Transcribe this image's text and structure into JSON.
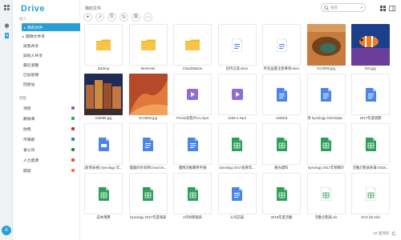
{
  "app": {
    "logo": "Drive"
  },
  "rail": {
    "icons": [
      "grid-icon",
      "bell-icon",
      "document-icon"
    ],
    "avatar": "A"
  },
  "sidebar": {
    "section_mine": "個人",
    "items": [
      {
        "label": "我的文件",
        "active": true,
        "caret": "▸"
      },
      {
        "label": "團隊文件夾",
        "caret": "▸"
      },
      {
        "label": "與我共享"
      },
      {
        "label": "與他人共享"
      },
      {
        "label": "最近瀏覽"
      },
      {
        "label": "已加星標"
      },
      {
        "label": "回收站"
      }
    ],
    "section_labels": "標籤",
    "labels": [
      {
        "label": "項目",
        "color": "#9b59b6"
      },
      {
        "label": "數據庫",
        "color": "#27ae60"
      },
      {
        "label": "財務",
        "color": "#c0392b"
      },
      {
        "label": "市場部",
        "color": "#2980b9"
      },
      {
        "label": "會公司",
        "color": "#1e8449"
      },
      {
        "label": "人力資源",
        "color": "#e74c3c"
      },
      {
        "label": "開發",
        "color": "#e67e22"
      }
    ]
  },
  "header": {
    "breadcrumb": "我的文件",
    "search_placeholder": "搜尋",
    "search_dropdown": "▾"
  },
  "toolbar": {
    "buttons": [
      "+",
      "↗",
      "⎘",
      "↻",
      "⧉",
      "⋯"
    ]
  },
  "files": [
    {
      "name": "Backup",
      "kind": "folder"
    },
    {
      "name": "Moments",
      "kind": "folder"
    },
    {
      "name": "CloudStation",
      "kind": "folder"
    },
    {
      "name": "招待方案.docx",
      "kind": "doc-light"
    },
    {
      "name": "所有設置注意事項.docx",
      "kind": "doc-light"
    },
    {
      "name": "GC0000.jpg",
      "kind": "img-canyon"
    },
    {
      "name": "fish.jpg",
      "kind": "img-fish"
    },
    {
      "name": "GM089.jpg",
      "kind": "img-town"
    },
    {
      "name": "GC0002.jpg",
      "kind": "img-rock"
    },
    {
      "name": "Presto短影片V1.mp4",
      "kind": "video"
    },
    {
      "name": "1268-1.mp4",
      "kind": "video"
    },
    {
      "name": "Untitled",
      "kind": "doc"
    },
    {
      "name": "用 Synology DS218pla...",
      "kind": "doc"
    },
    {
      "name": "2017年度規劃",
      "kind": "doc"
    },
    {
      "name": "[新增表格] Synology 年...",
      "kind": "slide"
    },
    {
      "name": "電腦同步與用Cloud St...",
      "kind": "doc"
    },
    {
      "name": "團隊活動費用申請",
      "kind": "doc"
    },
    {
      "name": "Synology 2017股東年...",
      "kind": "sheet"
    },
    {
      "name": "觀光資料",
      "kind": "sheet"
    },
    {
      "name": "Synology 2017年預算計",
      "kind": "sheet"
    },
    {
      "name": "活動計劃表負責-2018...",
      "kind": "sheet"
    },
    {
      "name": "成本預算",
      "kind": "sheet"
    },
    {
      "name": "Synology 2017年度報表",
      "kind": "sheet"
    },
    {
      "name": "4月財務報表",
      "kind": "sheet"
    },
    {
      "name": "公司訪談",
      "kind": "doc"
    },
    {
      "name": "2018年度活動",
      "kind": "sheet"
    },
    {
      "name": "活動企劃表.xls",
      "kind": "xls-light"
    },
    {
      "name": "XCS list.xlsx",
      "kind": "xls-light"
    }
  ],
  "status": {
    "count": "28 個項目",
    "refresh_icon": "refresh-icon"
  },
  "colors": {
    "accent": "#2a9fd6",
    "folder": "#f5b72b",
    "doc": "#4a86e8",
    "sheet": "#2e9e5b",
    "video": "#8e6fd1"
  }
}
